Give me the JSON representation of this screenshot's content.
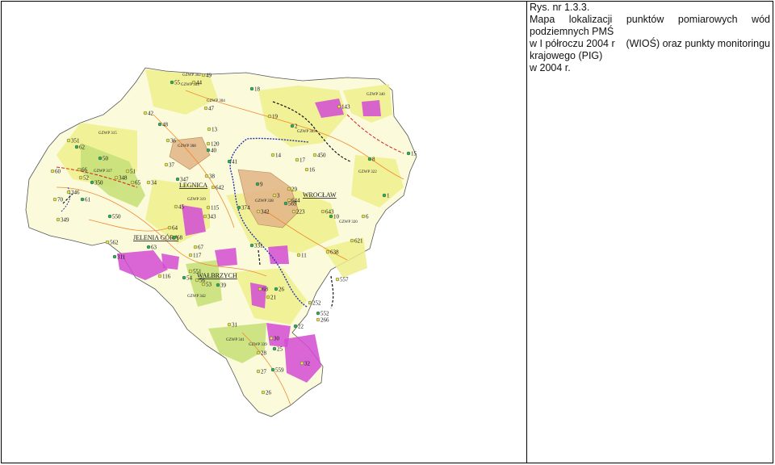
{
  "caption": {
    "number": "Rys. nr 1.3.3.",
    "line1_words": [
      "Mapa",
      "lokalizacji",
      "punktów",
      "pomiarowych",
      "wód"
    ],
    "line2": "podziemnych PMŚ",
    "line3_left": "w I półroczu 2004 r",
    "line3_right": "(WIOŚ) oraz punkty monitoringu",
    "line4": "krajowego (PIG)",
    "line5": "w 2004 r."
  },
  "map": {
    "colors": {
      "fill": "#fbfbdc",
      "yellow_gzwp": "#efef8c",
      "green": "#c8e07a",
      "magenta": "#d24bd2",
      "brown": "#e3b88a",
      "orange_line": "#f08a2a",
      "blue_river": "#2233aa",
      "red_boundary": "#d42020",
      "point_green": "#2bb35a",
      "point_yellow": "#e8e44a"
    },
    "cities": [
      "WROCŁAW",
      "LEGNICA",
      "WAŁBRZYCH",
      "JELENIA GÓRA"
    ],
    "gzwp_labels": [
      "GZWP 308",
      "GZWP 319",
      "GZWP 315",
      "GZWP 317",
      "GZWP 320",
      "GZWP 322",
      "GZWP 338",
      "GZWP 339",
      "GZWP 340",
      "GZWP 341",
      "GZWP 342",
      "GZWP 302",
      "GZWP 303",
      "GZWP 304",
      "GZWP 303"
    ],
    "points": [
      {
        "id": "55"
      },
      {
        "id": "49"
      },
      {
        "id": "44"
      },
      {
        "id": "18"
      },
      {
        "id": "47"
      },
      {
        "id": "42"
      },
      {
        "id": "48"
      },
      {
        "id": "13"
      },
      {
        "id": "19"
      },
      {
        "id": "2"
      },
      {
        "id": "143"
      },
      {
        "id": "351"
      },
      {
        "id": "62"
      },
      {
        "id": "36"
      },
      {
        "id": "120"
      },
      {
        "id": "40"
      },
      {
        "id": "14"
      },
      {
        "id": "450"
      },
      {
        "id": "15"
      },
      {
        "id": "60"
      },
      {
        "id": "66"
      },
      {
        "id": "50"
      },
      {
        "id": "51"
      },
      {
        "id": "37"
      },
      {
        "id": "41"
      },
      {
        "id": "17"
      },
      {
        "id": "16"
      },
      {
        "id": "8"
      },
      {
        "id": "52"
      },
      {
        "id": "348"
      },
      {
        "id": "350"
      },
      {
        "id": "65"
      },
      {
        "id": "34"
      },
      {
        "id": "347"
      },
      {
        "id": "38"
      },
      {
        "id": "642"
      },
      {
        "id": "9"
      },
      {
        "id": "29"
      },
      {
        "id": "3"
      },
      {
        "id": "1"
      },
      {
        "id": "346"
      },
      {
        "id": "70"
      },
      {
        "id": "61"
      },
      {
        "id": "45"
      },
      {
        "id": "115"
      },
      {
        "id": "374"
      },
      {
        "id": "342"
      },
      {
        "id": "644"
      },
      {
        "id": "569"
      },
      {
        "id": "223"
      },
      {
        "id": "643"
      },
      {
        "id": "10"
      },
      {
        "id": "6"
      },
      {
        "id": "349"
      },
      {
        "id": "550"
      },
      {
        "id": "343"
      },
      {
        "id": "64"
      },
      {
        "id": "68"
      },
      {
        "id": "562"
      },
      {
        "id": "621"
      },
      {
        "id": "311"
      },
      {
        "id": "67"
      },
      {
        "id": "117"
      },
      {
        "id": "331"
      },
      {
        "id": "11"
      },
      {
        "id": "638"
      },
      {
        "id": "63"
      },
      {
        "id": "116"
      },
      {
        "id": "551"
      },
      {
        "id": "54"
      },
      {
        "id": "56"
      },
      {
        "id": "53"
      },
      {
        "id": "39"
      },
      {
        "id": "557"
      },
      {
        "id": "68"
      },
      {
        "id": "26"
      },
      {
        "id": "21"
      },
      {
        "id": "252"
      },
      {
        "id": "552"
      },
      {
        "id": "266"
      },
      {
        "id": "31"
      },
      {
        "id": "22"
      },
      {
        "id": "30"
      },
      {
        "id": "28"
      },
      {
        "id": "25"
      },
      {
        "id": "32"
      },
      {
        "id": "27"
      },
      {
        "id": "559"
      },
      {
        "id": "26"
      }
    ]
  }
}
